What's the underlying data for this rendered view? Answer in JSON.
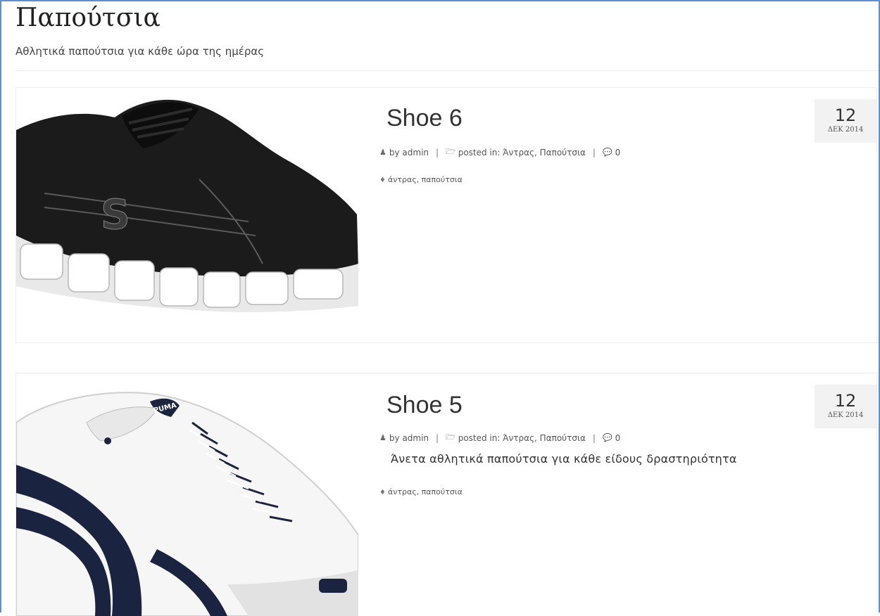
{
  "page": {
    "title": "Παπούτσια",
    "subtitle": "Αθλητικά παπούτσια για κάθε ώρα της ημέρας"
  },
  "posts": [
    {
      "title": "Shoe 6",
      "meta": {
        "author_icon": "user-icon",
        "author": "by admin",
        "sep1": "|",
        "category_icon": "folder-open-icon",
        "posted_in": "posted in: Άντρας, Παπούτσια",
        "sep2": "|",
        "comments_icon": "comments-icon",
        "comments": "0"
      },
      "excerpt": "",
      "tags_icon": "tag-icon",
      "tags": "άντρας, παπούτσια",
      "date": {
        "day": "12",
        "month_year": "ΔΕΚ 2014"
      },
      "image": "black-sneaker-image"
    },
    {
      "title": "Shoe 5",
      "meta": {
        "author_icon": "user-icon",
        "author": "by admin",
        "sep1": "|",
        "category_icon": "folder-open-icon",
        "posted_in": "posted in: Άντρας, Παπούτσια",
        "sep2": "|",
        "comments_icon": "comments-icon",
        "comments": "0"
      },
      "excerpt": "Άνετα αθλητικά παπούτσια για κάθε είδους δραστηριότητα",
      "tags_icon": "tag-icon",
      "tags": "άντρας, παπούτσια",
      "date": {
        "day": "12",
        "month_year": "ΔΕΚ 2014"
      },
      "image": "white-sneaker-image"
    }
  ],
  "colors": {
    "frame": "#5b8fd0",
    "date_bg": "#f2f2f2",
    "text": "#333333"
  }
}
